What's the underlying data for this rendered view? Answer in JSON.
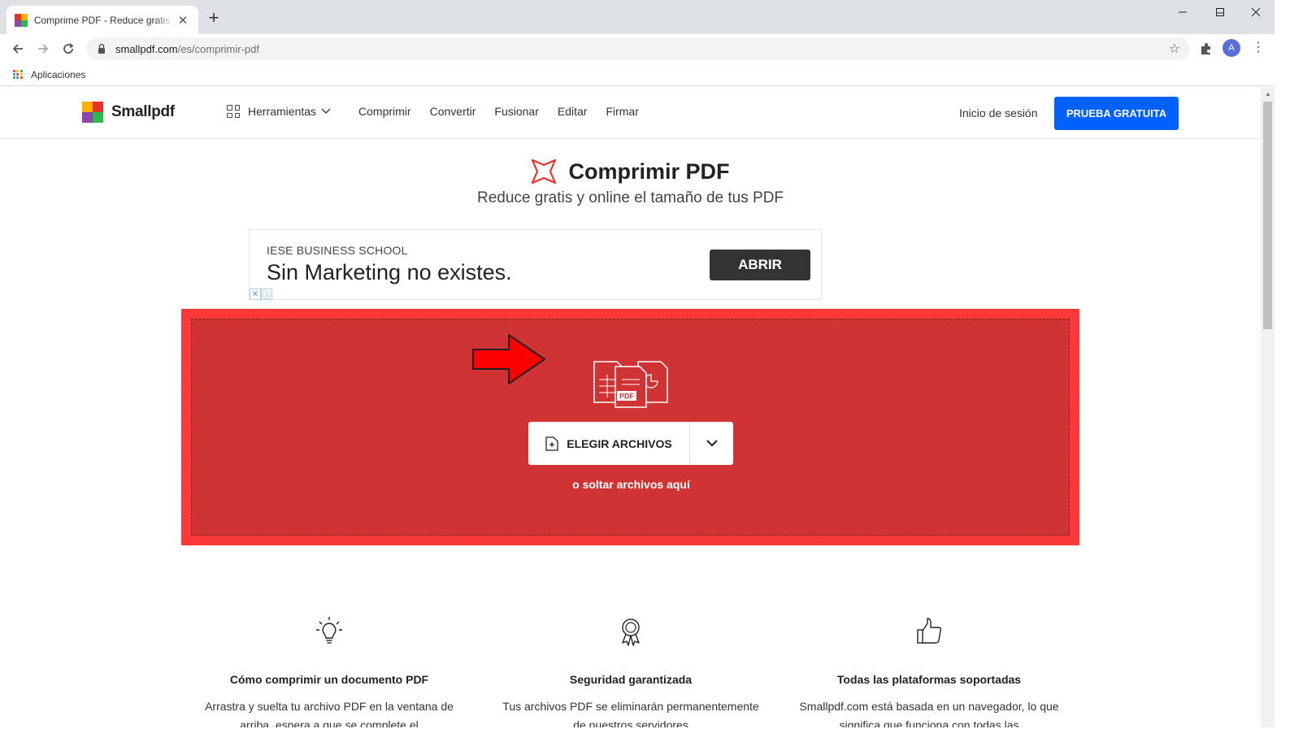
{
  "browser": {
    "tab_title": "Comprime PDF - Reduce gratis y online el tamaño de tus PDF",
    "tab_close": "✕",
    "new_tab": "+",
    "url_host": "smallpdf.com",
    "url_path": "/es/comprimir-pdf",
    "profile_initial": "A",
    "bookmark_label": "Aplicaciones",
    "minimize": "–",
    "maximize": "☐",
    "close": "✕"
  },
  "header": {
    "logo_text": "Smallpdf",
    "tools_label": "Herramientas",
    "nav": [
      "Comprimir",
      "Convertir",
      "Fusionar",
      "Editar",
      "Firmar"
    ],
    "signin": "Inicio de sesión",
    "trial": "PRUEBA GRATUITA"
  },
  "hero": {
    "title": "Comprimir PDF",
    "subtitle": "Reduce gratis y online el tamaño de tus PDF",
    "accent_color": "#e5322d"
  },
  "ad": {
    "brand": "IESE BUSINESS SCHOOL",
    "headline": "Sin Marketing no existes.",
    "button": "ABRIR"
  },
  "dropzone": {
    "choose_label": "ELEGIR ARCHIVOS",
    "drop_text": "o soltar archivos aquí",
    "files_icon_label": "PDF"
  },
  "features": [
    {
      "icon": "lightbulb-icon",
      "title": "Cómo comprimir un documento PDF",
      "text": "Arrastra y suelta tu archivo PDF en la ventana de arriba, espera a que se complete el"
    },
    {
      "icon": "award-ribbon-icon",
      "title": "Seguridad garantizada",
      "text": "Tus archivos PDF se eliminarán permanentemente de nuestros servidores"
    },
    {
      "icon": "thumbs-up-icon",
      "title": "Todas las plataformas soportadas",
      "text": "Smallpdf.com está basada en un navegador, lo que significa que funciona con todas las"
    }
  ]
}
